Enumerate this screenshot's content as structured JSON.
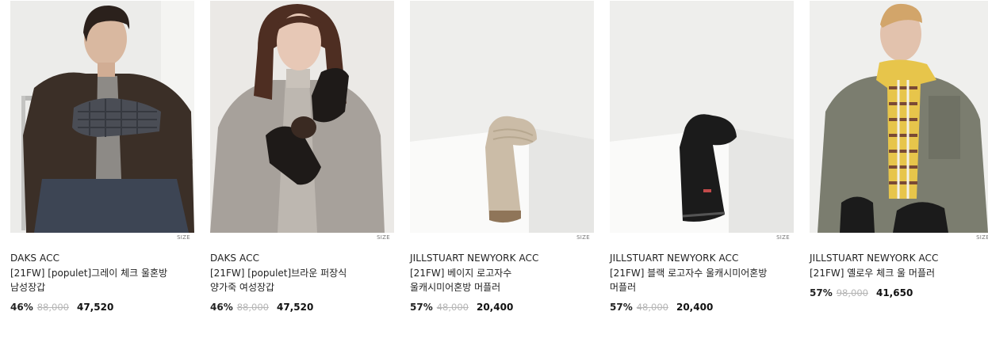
{
  "products": [
    {
      "brand": "DAKS ACC",
      "name": "[21FW] [populet]그레이 체크 울혼방 남성장갑",
      "size_label": "SIZE",
      "discount": "46%",
      "original_price": "88,000",
      "sale_price": "47,520",
      "image": "man-gray-check-gloves"
    },
    {
      "brand": "DAKS ACC",
      "name": "[21FW] [populet]브라운 퍼장식 양가죽 여성장갑",
      "size_label": "SIZE",
      "discount": "46%",
      "original_price": "88,000",
      "sale_price": "47,520",
      "image": "woman-leather-gloves"
    },
    {
      "brand": "JILLSTUART NEWYORK ACC",
      "name": "[21FW] 베이지 로고자수 울캐시미어혼방 머플러",
      "size_label": "SIZE",
      "discount": "57%",
      "original_price": "48,000",
      "sale_price": "20,400",
      "image": "beige-knit-muffler"
    },
    {
      "brand": "JILLSTUART NEWYORK ACC",
      "name": "[21FW] 블랙 로고자수 울캐시미어혼방 머플러",
      "size_label": "SIZE",
      "discount": "57%",
      "original_price": "48,000",
      "sale_price": "20,400",
      "image": "black-knit-muffler"
    },
    {
      "brand": "JILLSTUART NEWYORK ACC",
      "name": "[21FW] 옐로우 체크 울 머플러",
      "size_label": "SIZE",
      "discount": "57%",
      "original_price": "98,000",
      "sale_price": "41,650",
      "image": "man-yellow-check-scarf"
    }
  ],
  "colors": {
    "text": "#222222",
    "strike": "#b5b5b5",
    "image_bg_light": "#eeeeec",
    "studio_bg": "#f0f0ef"
  }
}
